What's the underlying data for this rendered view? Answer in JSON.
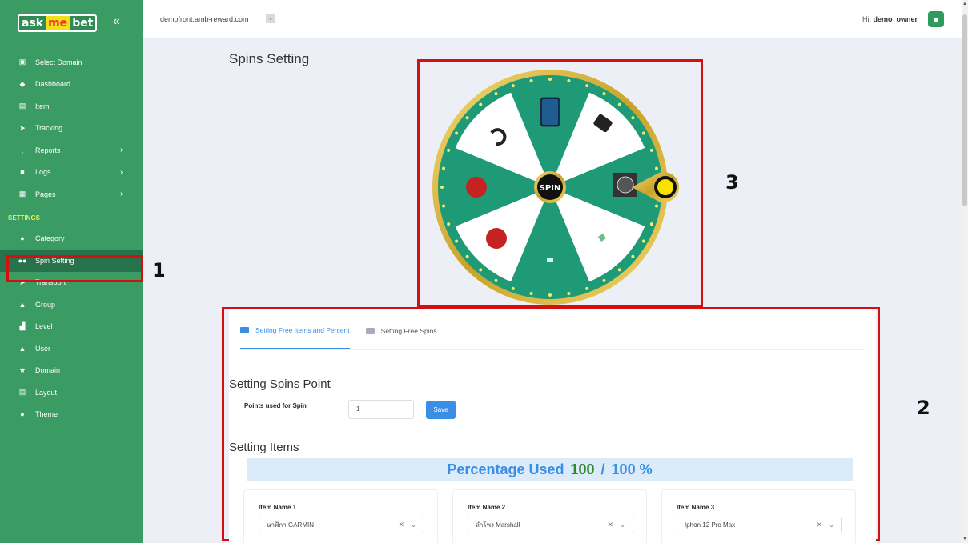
{
  "sidebar": {
    "brand": [
      "ask",
      "me",
      "bet"
    ],
    "collapse_icon": "double-chevron-left-icon",
    "items": [
      {
        "label": "Select Domain",
        "icon": "domain-icon",
        "chevron": ""
      },
      {
        "label": "Dashboard",
        "icon": "diamond-icon",
        "chevron": ""
      },
      {
        "label": "Item",
        "icon": "gift-icon",
        "chevron": ""
      },
      {
        "label": "Tracking",
        "icon": "tracking-icon",
        "chevron": ""
      },
      {
        "label": "Reports",
        "icon": "chart-icon",
        "chevron": "›"
      },
      {
        "label": "Logs",
        "icon": "folder-icon",
        "chevron": "›"
      },
      {
        "label": "Pages",
        "icon": "pages-icon",
        "chevron": "›"
      }
    ],
    "settings_title": "SETTINGS",
    "settings_items": [
      {
        "label": "Category",
        "icon": "category-icon"
      },
      {
        "label": "Spin Setting",
        "icon": "gamepad-icon"
      },
      {
        "label": "Transport",
        "icon": "send-icon"
      },
      {
        "label": "Group",
        "icon": "group-icon"
      },
      {
        "label": "Level",
        "icon": "level-icon"
      },
      {
        "label": "User",
        "icon": "user-icon"
      },
      {
        "label": "Domain",
        "icon": "star-icon"
      },
      {
        "label": "Layout",
        "icon": "layout-icon"
      },
      {
        "label": "Theme",
        "icon": "theme-icon"
      }
    ]
  },
  "topbar": {
    "domain": "demofront.amb-reward.com",
    "greeting_prefix": "Hi,",
    "username": "demo_owner"
  },
  "page": {
    "title": "Spins Setting"
  },
  "wheel": {
    "center_label": "SPIN",
    "colors": {
      "green": "#1f9a77",
      "gold": "#c9a227",
      "white": "#ffffff"
    }
  },
  "callouts": {
    "one": "1",
    "two": "2",
    "three": "3"
  },
  "tabs": [
    {
      "label": "Setting Free Items and Percent",
      "active": true
    },
    {
      "label": "Setting Free Spins",
      "active": false
    }
  ],
  "spins_point": {
    "heading": "Setting Spins Point",
    "label": "Points used for Spin",
    "value": "1",
    "save_label": "Save"
  },
  "items_section": {
    "heading": "Setting Items",
    "percentage_prefix": "Percentage Used",
    "used": "100",
    "separator": "/",
    "total": "100 %",
    "items": [
      {
        "label": "Item Name 1",
        "value": "นาฬิกา GARMIN"
      },
      {
        "label": "Item Name 2",
        "value": "ลำโพง Marshall"
      },
      {
        "label": "Item Name 3",
        "value": "Iphon 12 Pro Max"
      }
    ]
  },
  "colors": {
    "sidebar": "#3a9b63",
    "accent": "#3a8ee6",
    "highlight": "#d50f10"
  }
}
